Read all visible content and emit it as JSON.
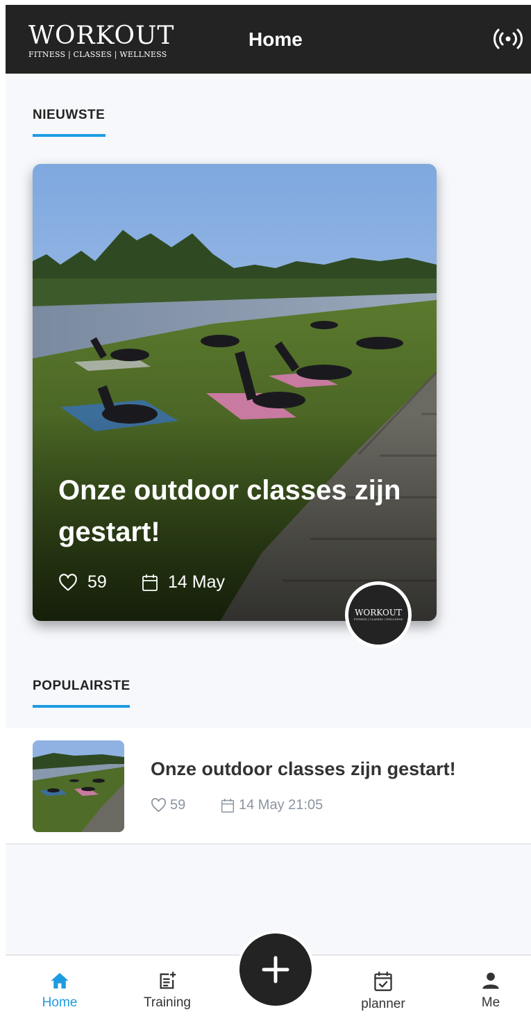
{
  "app_bar": {
    "logo_main": "WORKOUT",
    "logo_sub": "FITNESS | CLASSES | WELLNESS",
    "title": "Home",
    "broadcast_icon": "broadcast-icon"
  },
  "sections": {
    "newest": "NIEUWSTE",
    "popular": "POPULAIRSTE"
  },
  "featured": {
    "title": "Onze outdoor classes zijn gestart!",
    "likes": "59",
    "date": "14 May",
    "author_logo_main": "WORKOUT",
    "author_logo_sub": "FITNESS | CLASSES | WELLNESS"
  },
  "popular_items": [
    {
      "title": "Onze outdoor classes zijn gestart!",
      "likes": "59",
      "date": "14 May 21:05"
    }
  ],
  "bottom_nav": {
    "items": [
      {
        "label": "Home",
        "icon": "home-icon",
        "active": true
      },
      {
        "label": "Training",
        "icon": "post-add-icon",
        "active": false
      },
      {
        "label": "planner",
        "icon": "calendar-check-icon",
        "active": false
      },
      {
        "label": "Me",
        "icon": "person-icon",
        "active": false
      }
    ],
    "fab_icon": "plus-icon"
  },
  "colors": {
    "app_bar": "#232323",
    "accent": "#1e9be0",
    "background": "#f6f8fc"
  }
}
